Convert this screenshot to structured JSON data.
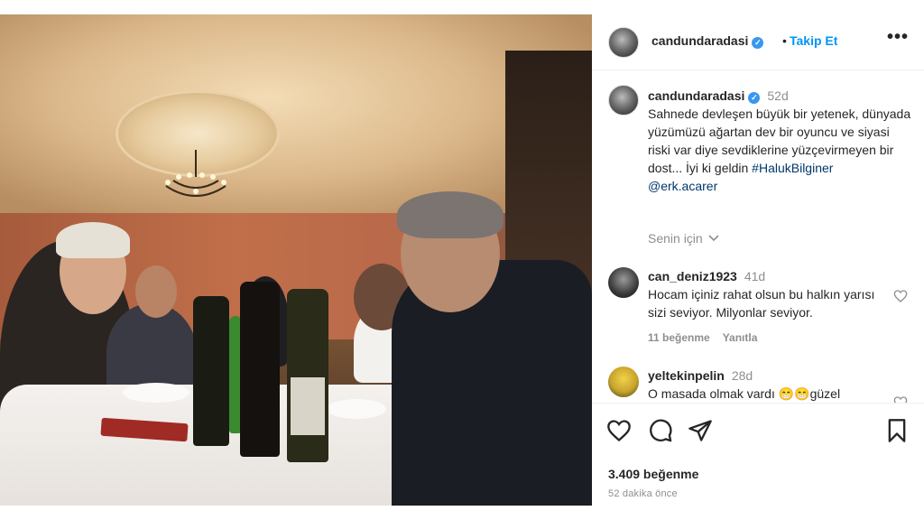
{
  "post": {
    "username": "candundaradasi",
    "follow_label": "Takip Et",
    "separator": "•",
    "more_label": "•••"
  },
  "caption": {
    "username": "candundaradasi",
    "time": "52d",
    "text": "Sahnede devleşen büyük bir yetenek, dünyada yüzümüzü ağartan dev bir oyuncu ve siyasi riski var diye sevdiklerine yüzçevirmeyen bir dost... İyi ki geldin ",
    "hashtag": "#HalukBilginer",
    "mention": "@erk.acarer",
    "translate_label": "Senin için"
  },
  "comments": [
    {
      "username": "can_deniz1923",
      "time": "41d",
      "text": "Hocam içiniz rahat olsun bu halkın yarısı sizi seviyor. Milyonlar seviyor.",
      "likes_label": "11 beğenme",
      "reply_label": "Yanıtla"
    },
    {
      "username": "yeltekinpelin",
      "time": "28d",
      "text": "O masada olmak vardı 😁😁güzel"
    }
  ],
  "footer": {
    "likes": "3.409 beğenme",
    "time_ago": "52 dakika önce"
  },
  "icons": [
    "verified-badge-icon",
    "more-icon",
    "chevron-down-icon",
    "heart-icon",
    "comment-icon",
    "share-icon",
    "bookmark-icon"
  ],
  "colors": {
    "link": "#0095f6",
    "verified": "#3897f0",
    "muted": "#8e8e8e",
    "tag": "#00376b"
  }
}
